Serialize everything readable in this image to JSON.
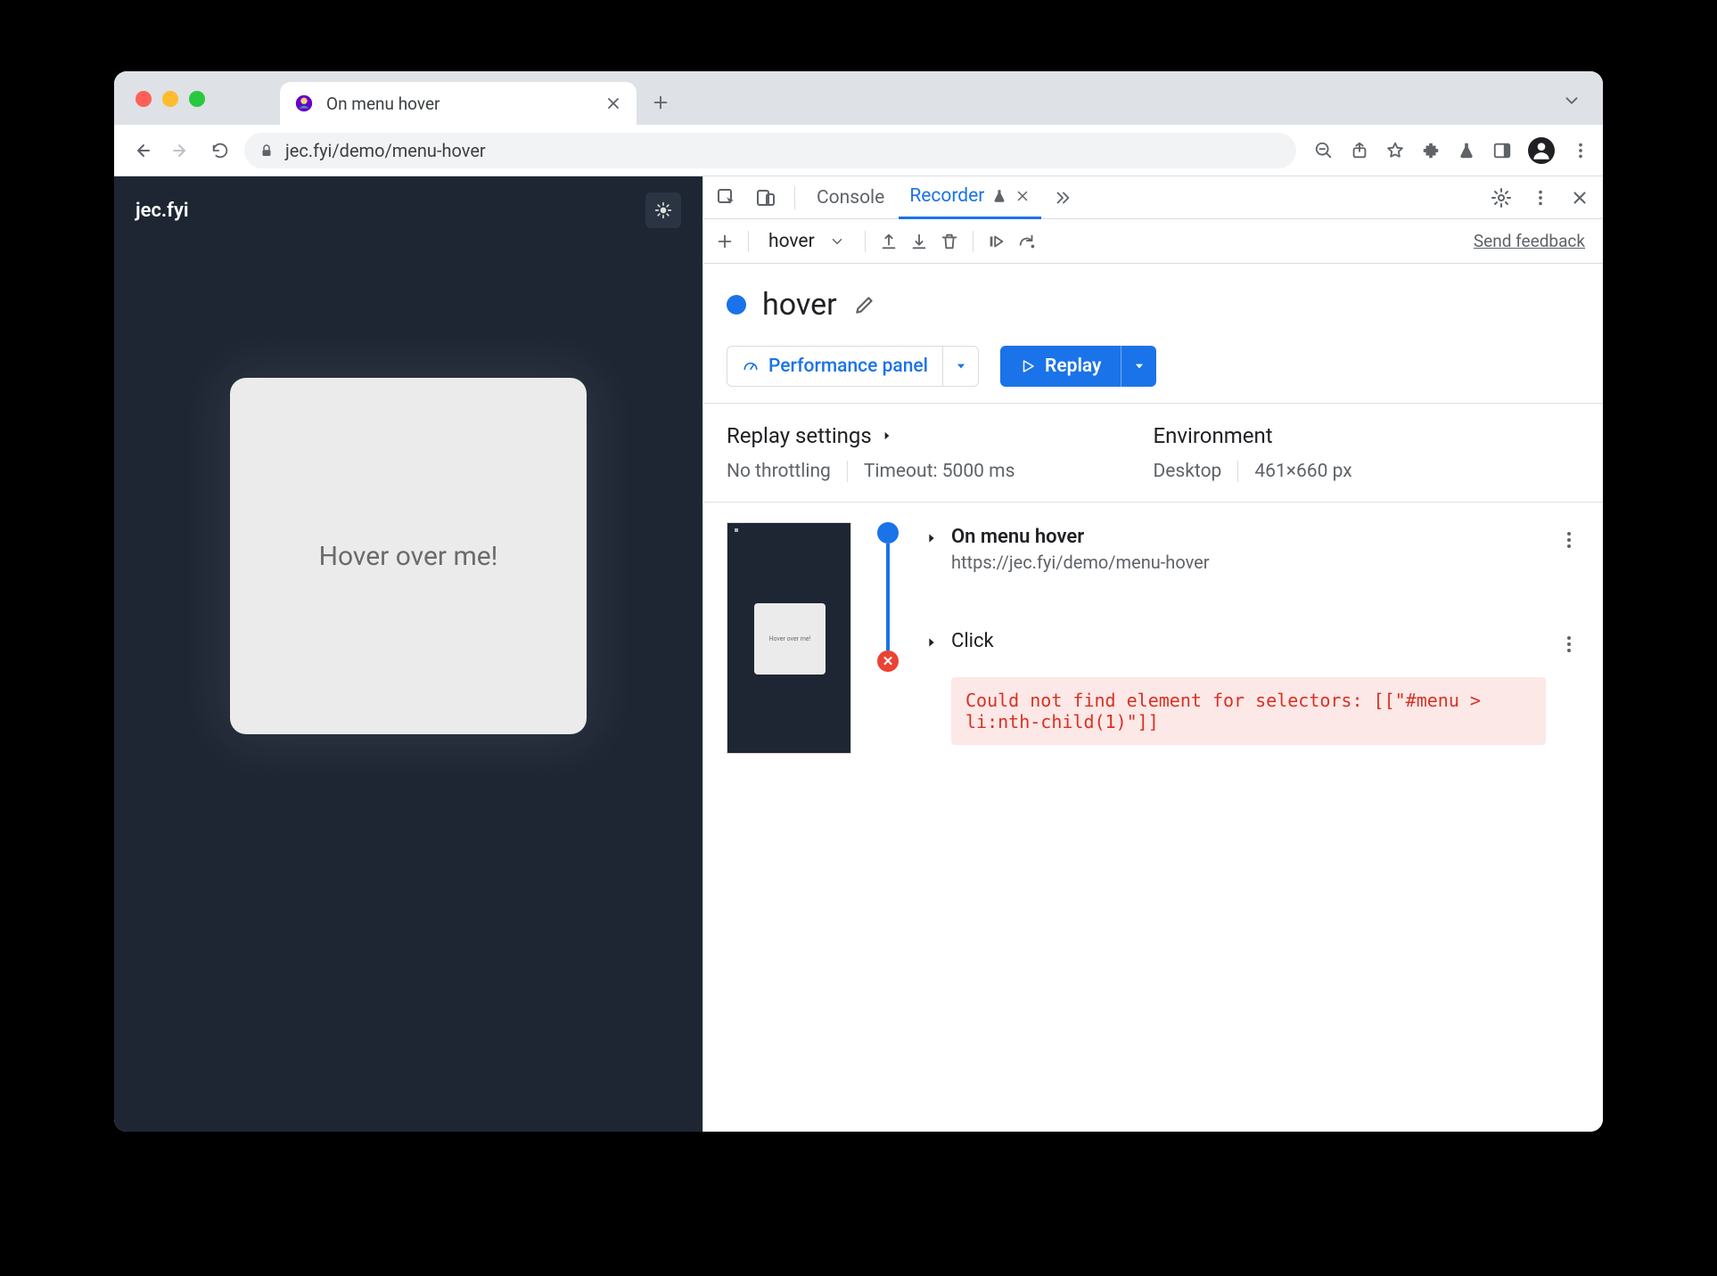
{
  "browser": {
    "tab_title": "On menu hover",
    "url": "jec.fyi/demo/menu-hover"
  },
  "page": {
    "site_name": "jec.fyi",
    "card_text": "Hover over me!",
    "thumb_text": "Hover over me!"
  },
  "devtools": {
    "tabs": {
      "console": "Console",
      "recorder": "Recorder"
    },
    "recording_select": "hover",
    "send_feedback": "Send feedback",
    "title": "hover",
    "perf_panel": "Performance panel",
    "replay": "Replay",
    "settings": {
      "replay_label": "Replay settings",
      "throttling": "No throttling",
      "timeout": "Timeout: 5000 ms",
      "env_label": "Environment",
      "device": "Desktop",
      "dims": "461×660 px"
    },
    "steps": {
      "s1_title": "On menu hover",
      "s1_url": "https://jec.fyi/demo/menu-hover",
      "s2_title": "Click",
      "error": "Could not find element for selectors: [[\"#menu > li:nth-child(1)\"]]"
    }
  }
}
